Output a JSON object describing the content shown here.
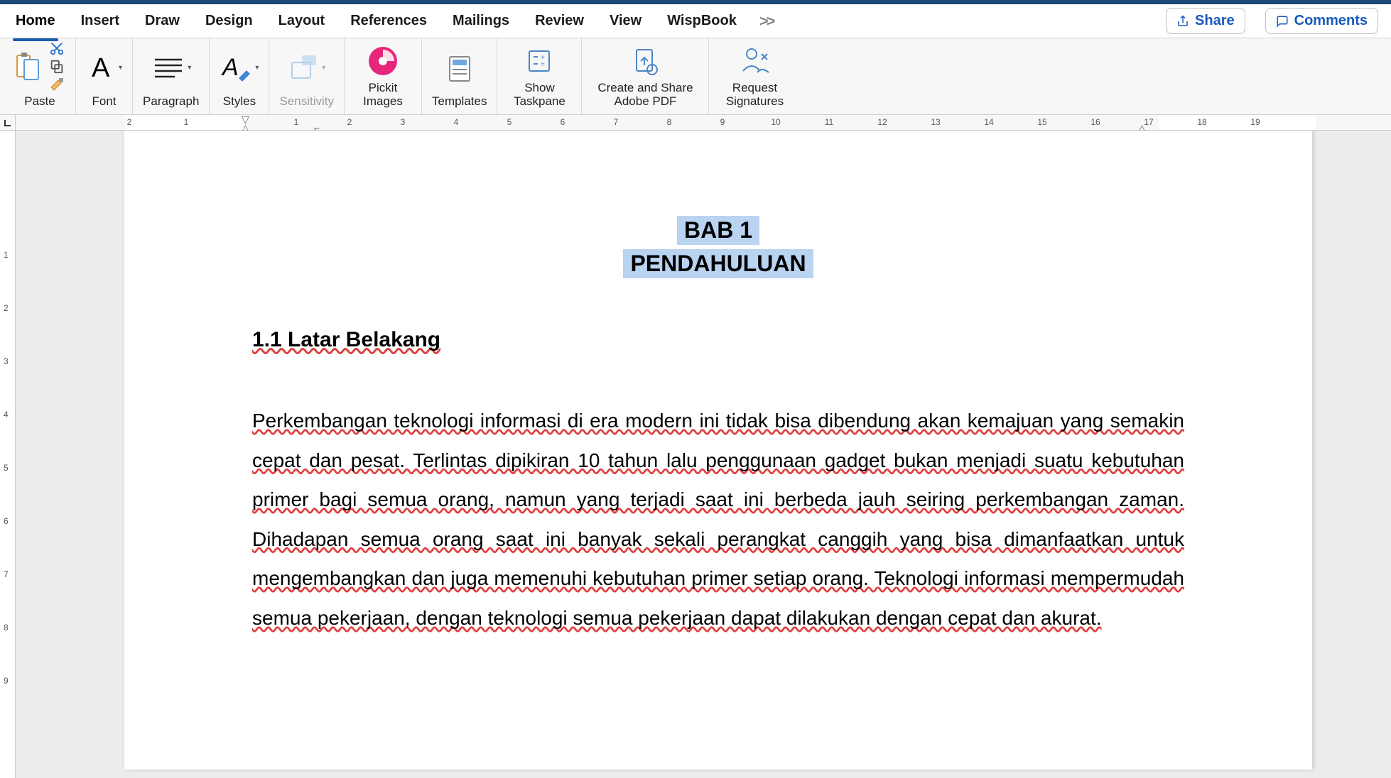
{
  "tabs": [
    "Home",
    "Insert",
    "Draw",
    "Design",
    "Layout",
    "References",
    "Mailings",
    "Review",
    "View",
    "WispBook"
  ],
  "active_tab": "Home",
  "share": "Share",
  "comments": "Comments",
  "groups": {
    "paste": "Paste",
    "font": "Font",
    "paragraph": "Paragraph",
    "styles": "Styles",
    "sensitivity": "Sensitivity",
    "pickit": "Pickit Images",
    "templates": "Templates",
    "taskpane": "Show Taskpane",
    "adobe": "Create and Share Adobe PDF",
    "sign": "Request Signatures"
  },
  "ruler_h": [
    2,
    1,
    1,
    2,
    3,
    4,
    5,
    6,
    7,
    8,
    9,
    10,
    11,
    12,
    13,
    14,
    15,
    16,
    17,
    18,
    19
  ],
  "ruler_v": [
    1,
    2,
    3,
    4,
    5,
    6,
    7,
    8,
    9
  ],
  "doc": {
    "title1": "BAB 1",
    "title2": "PENDAHULUAN",
    "section": "1.1 Latar Belakang",
    "para": "Perkembangan teknologi informasi di era modern ini tidak bisa dibendung akan kemajuan yang semakin cepat dan pesat. Terlintas dipikiran 10 tahun lalu penggunaan gadget bukan menjadi suatu kebutuhan primer bagi semua orang, namun yang terjadi saat ini berbeda jauh seiring perkembangan zaman. Dihadapan semua orang saat ini banyak sekali perangkat canggih yang bisa dimanfaatkan untuk mengembangkan dan juga memenuhi kebutuhan primer setiap orang. Teknologi informasi mempermudah semua pekerjaan, dengan teknologi semua pekerjaan dapat dilakukan dengan cepat dan akurat."
  }
}
